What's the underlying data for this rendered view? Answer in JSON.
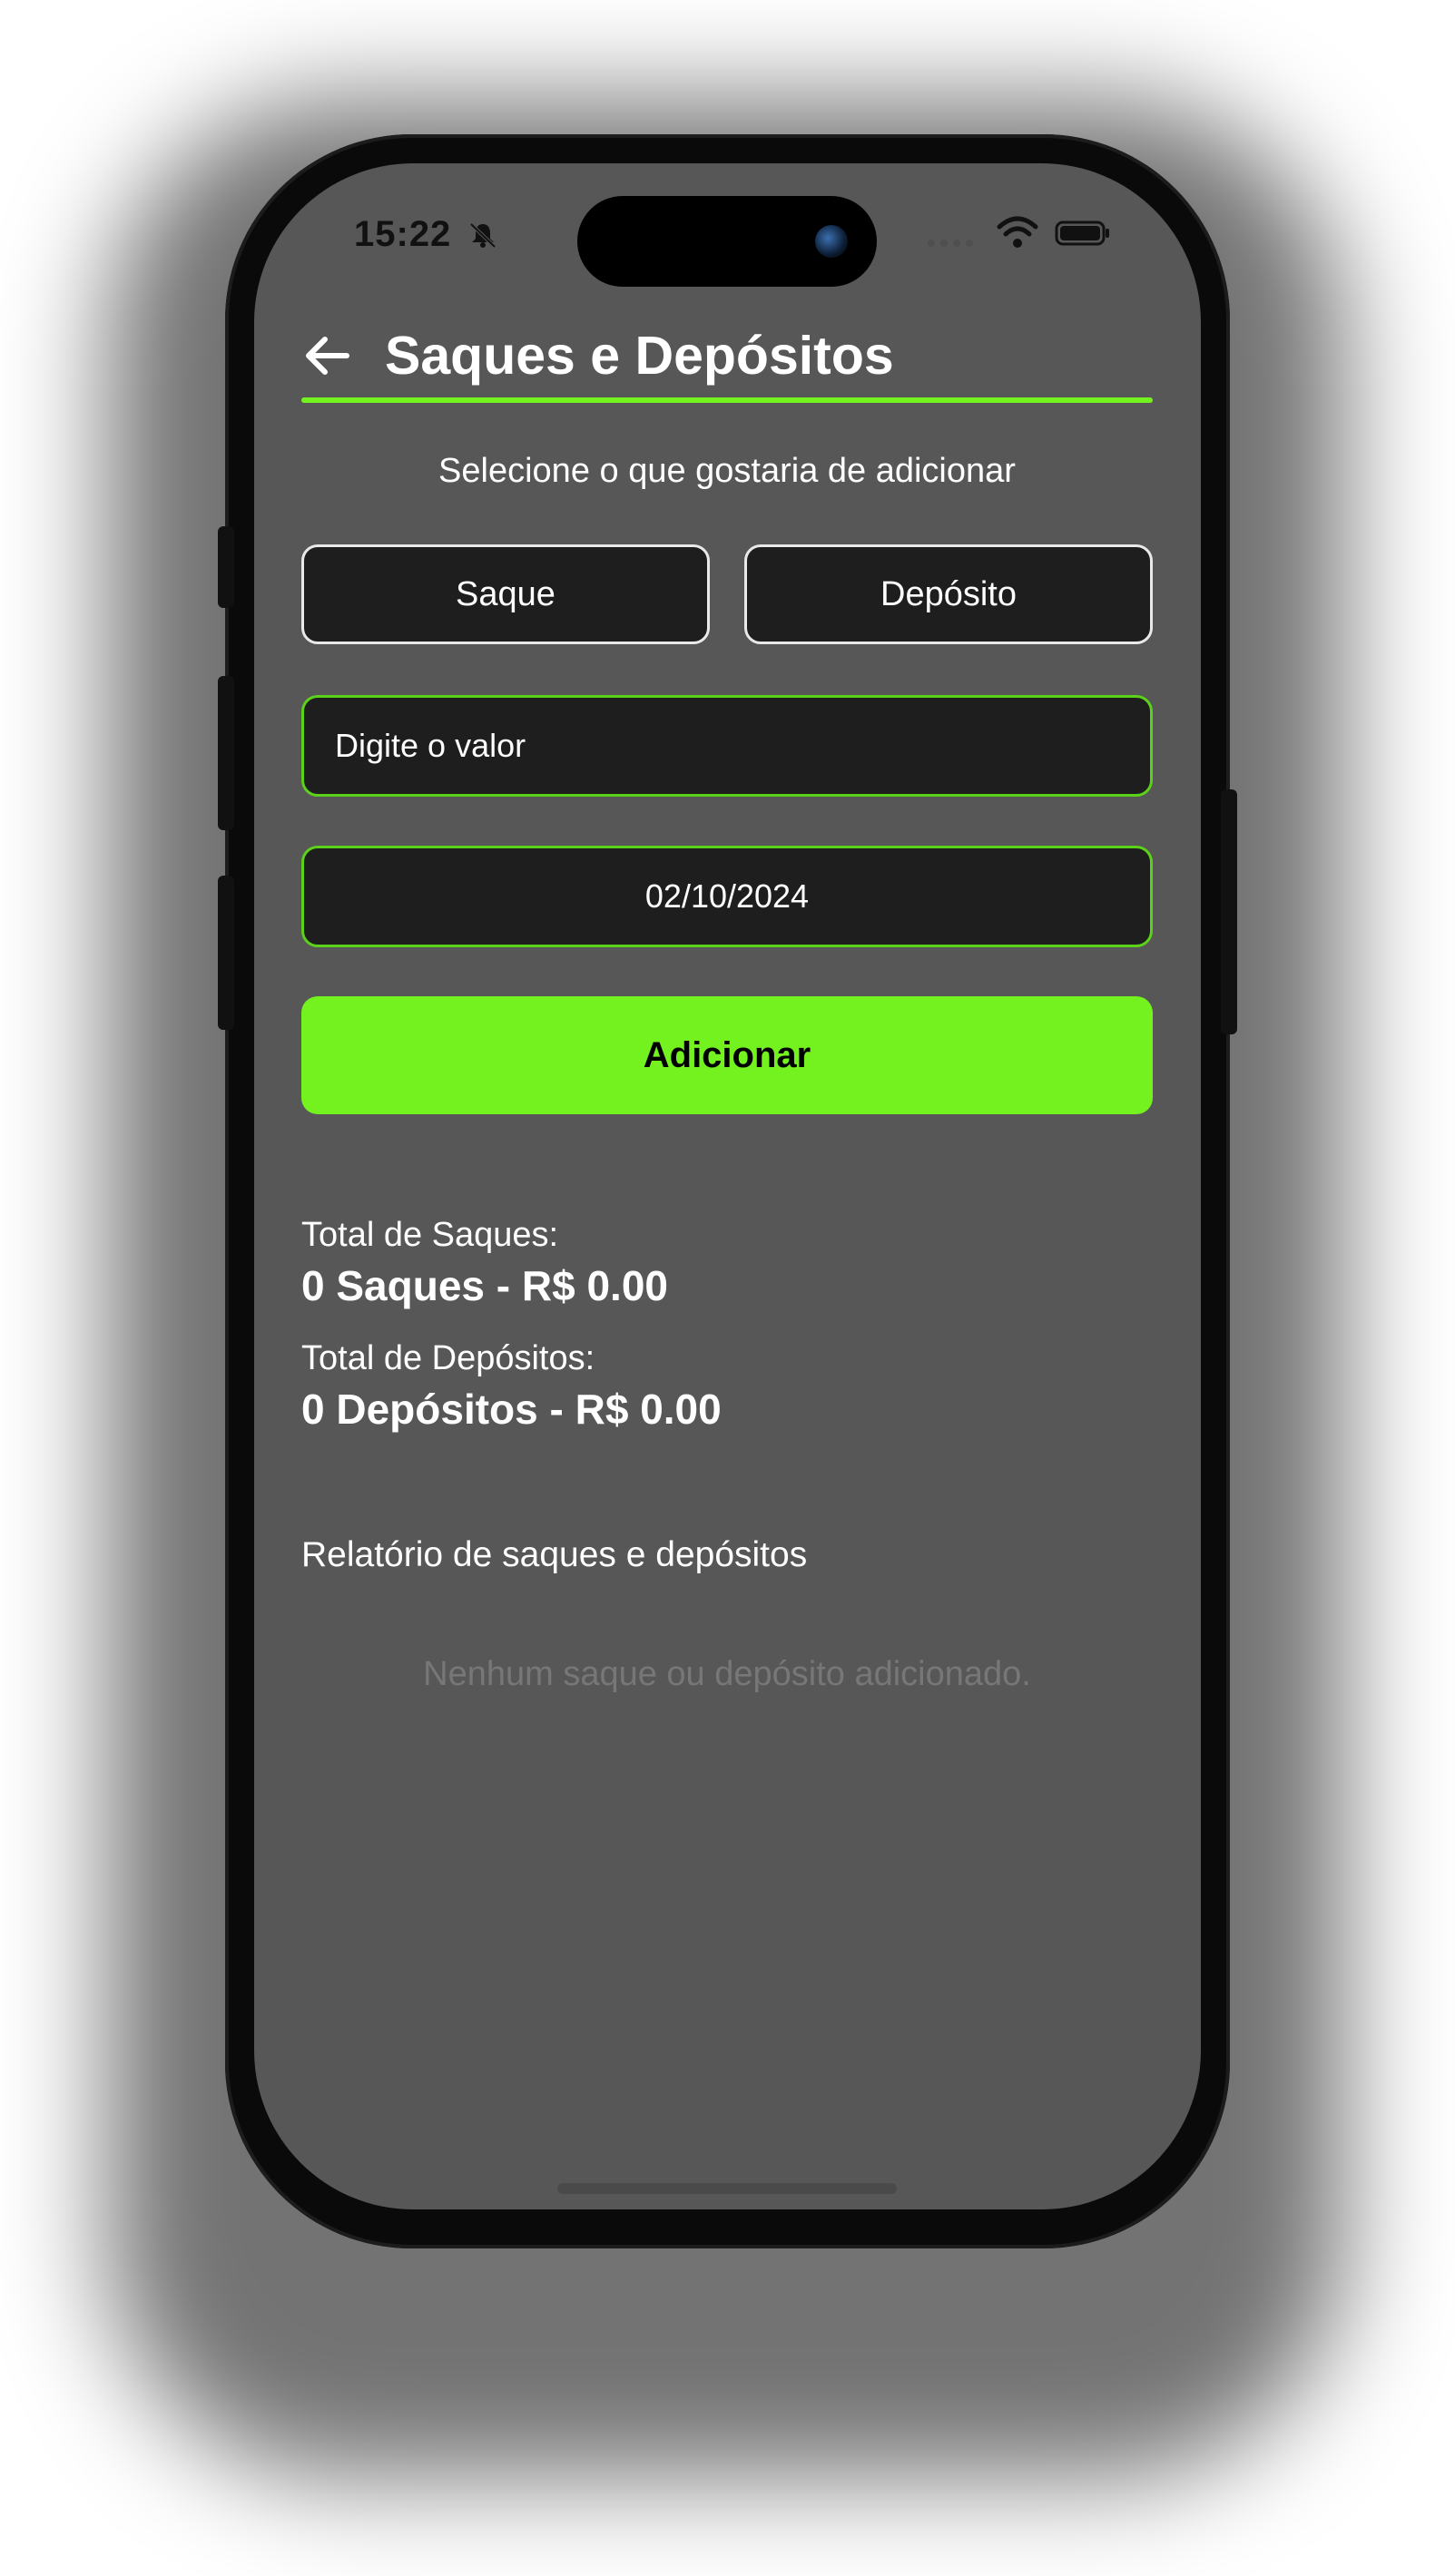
{
  "status_bar": {
    "time": "15:22",
    "icons": [
      "bell-muted-icon",
      "signal-icon",
      "wifi-icon",
      "battery-icon"
    ]
  },
  "header": {
    "back_icon": "arrow-left-icon",
    "title": "Saques e Depósitos"
  },
  "form": {
    "prompt": "Selecione o que gostaria de adicionar",
    "withdraw_label": "Saque",
    "deposit_label": "Depósito",
    "value_placeholder": "Digite o valor",
    "date_value": "02/10/2024",
    "add_label": "Adicionar"
  },
  "totals": {
    "withdrawals_label": "Total de Saques:",
    "withdrawals_value": "0 Saques - R$ 0.00",
    "deposits_label": "Total de Depósitos:",
    "deposits_value": "0 Depósitos - R$ 0.00"
  },
  "report": {
    "title": "Relatório de saques e depósitos",
    "empty_message": "Nenhum saque ou depósito adicionado."
  },
  "colors": {
    "accent": "#74f220",
    "screen_background": "#575757",
    "field_background": "#1e1e1e"
  }
}
